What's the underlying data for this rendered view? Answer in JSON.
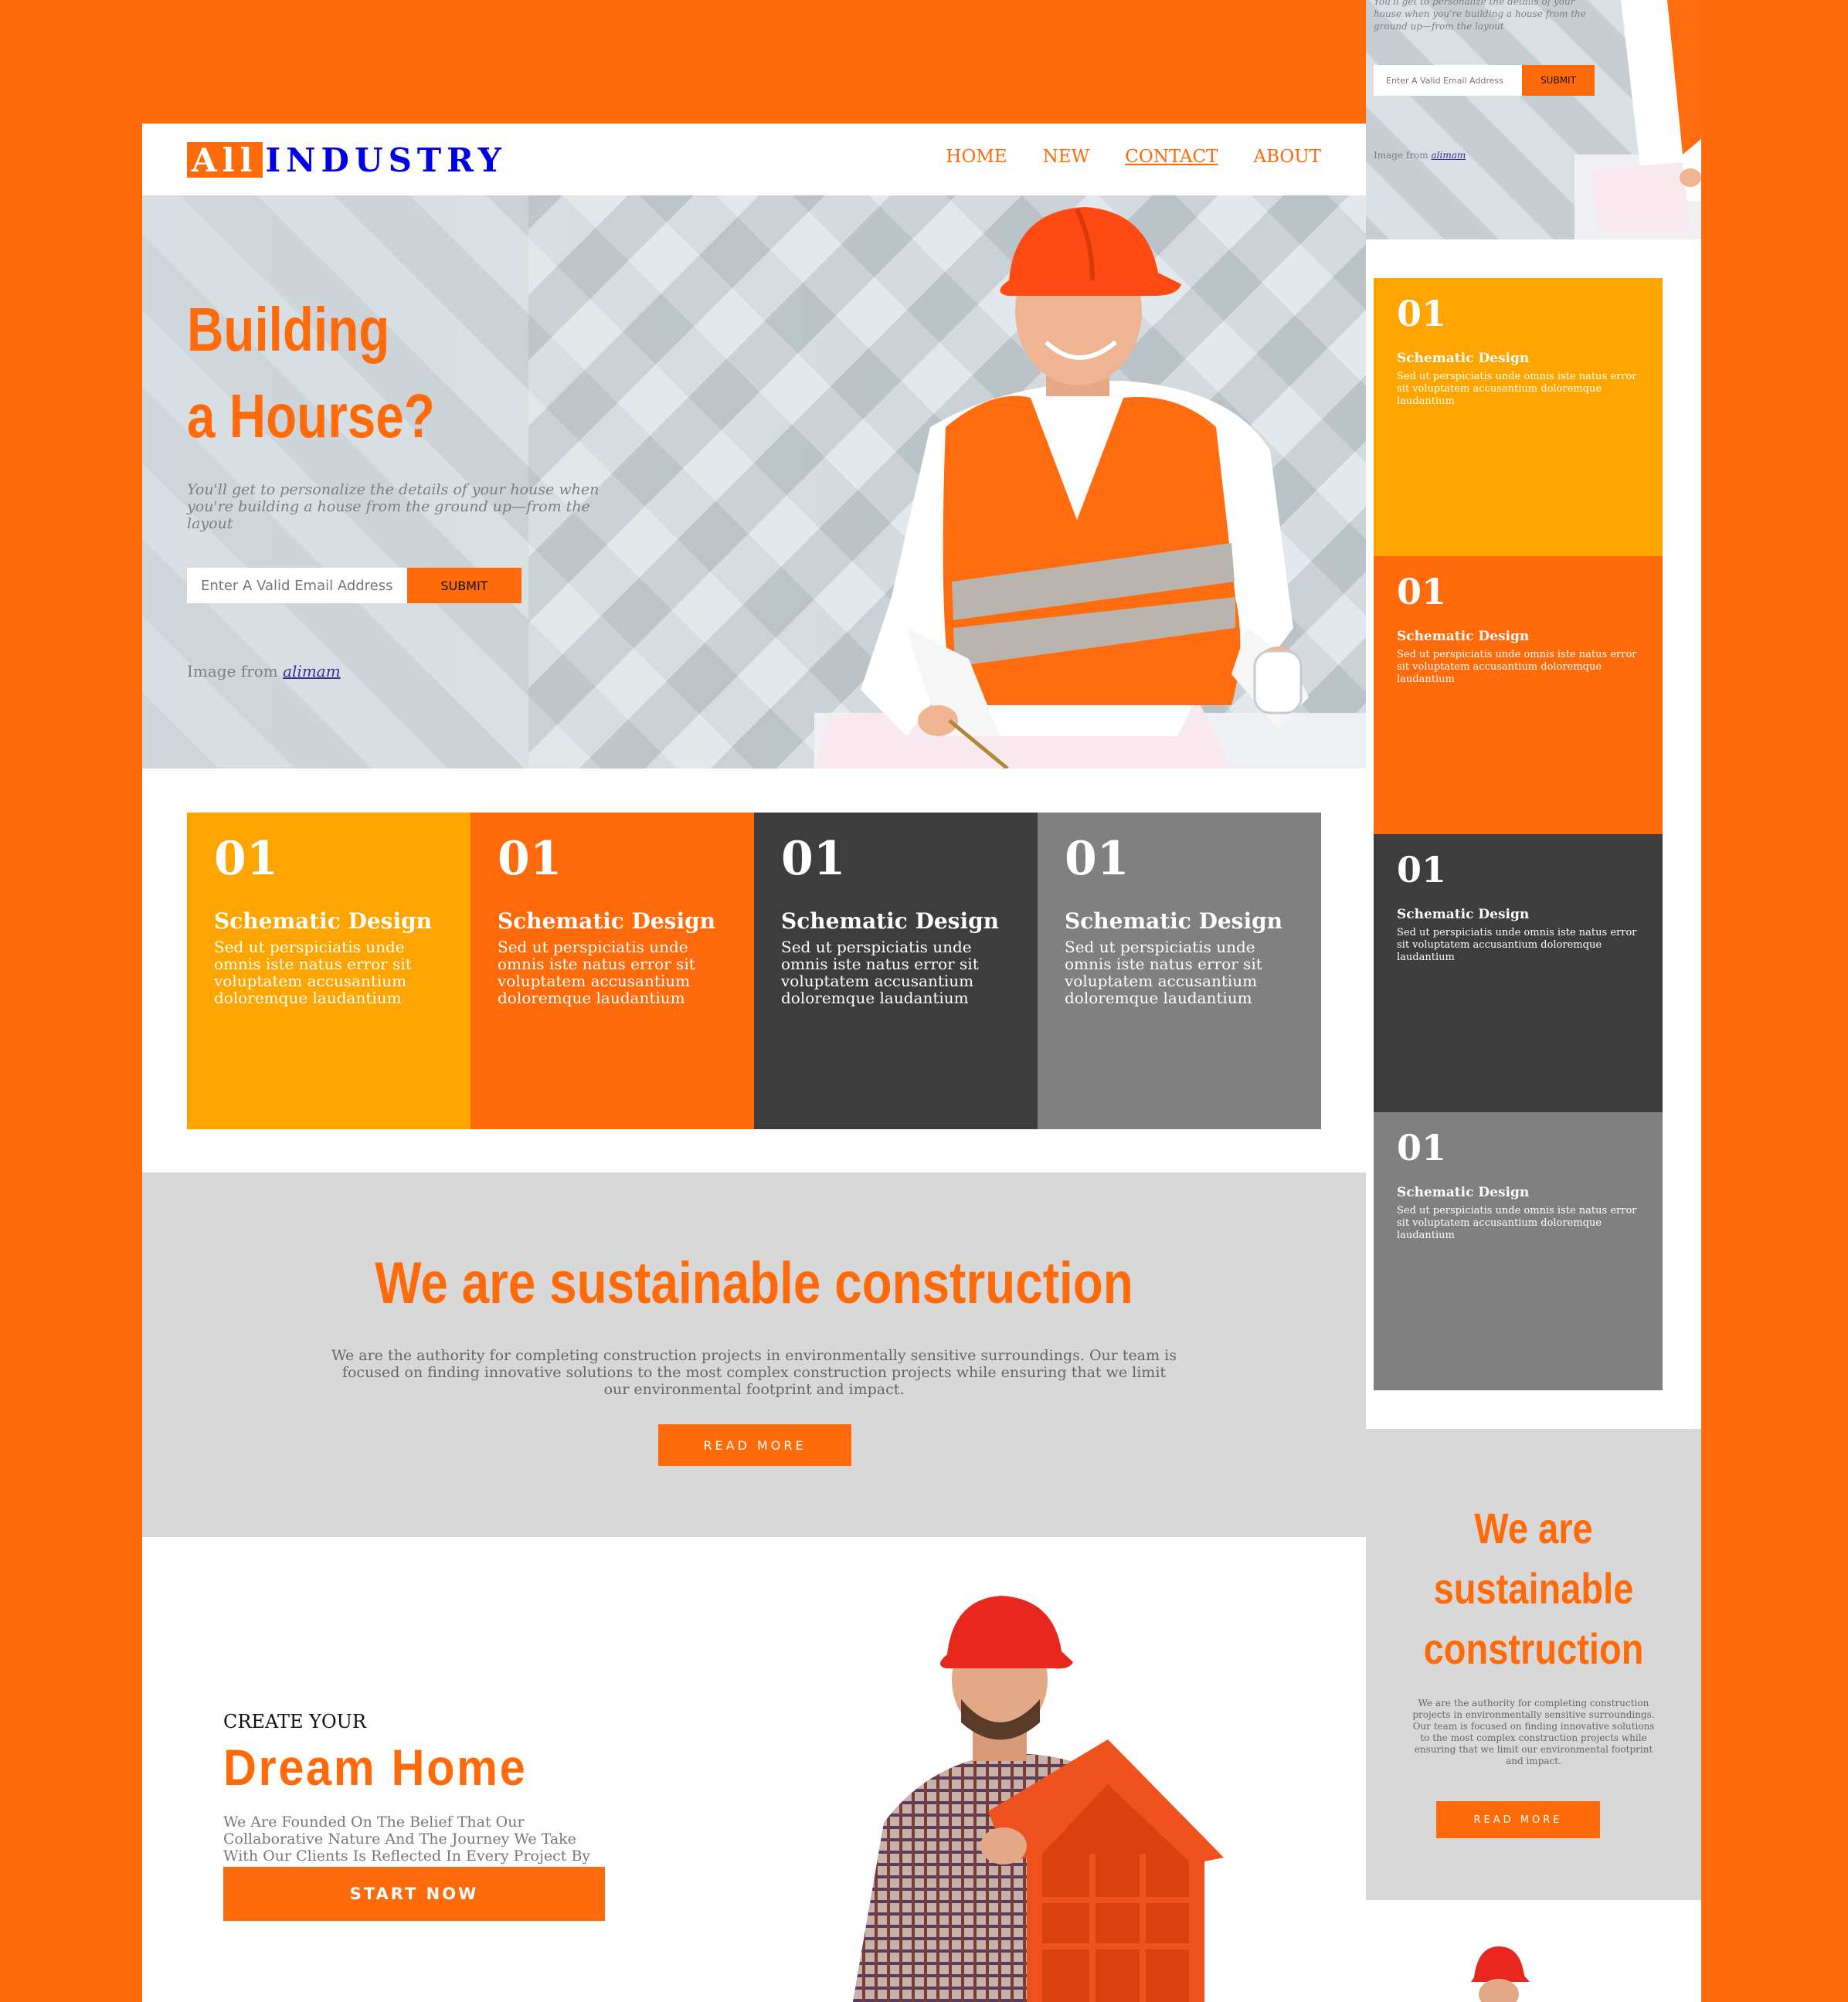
{
  "brand": {
    "part1": "All",
    "part2": "INDUSTRY"
  },
  "nav": {
    "items": [
      "HOME",
      "NEW",
      "CONTACT",
      "ABOUT"
    ],
    "active": "CONTACT"
  },
  "hero": {
    "title_line1": "Building",
    "title_line2": "a Hourse?",
    "subtitle": "You'll get to personalize the details of your house when you're building a house from the ground up—from the layout",
    "email_placeholder": "Enter A Valid Email Address",
    "submit_label": "SUBMIT",
    "credit_prefix": "Image from",
    "credit_link": "alimam"
  },
  "cards": [
    {
      "number": "01",
      "title": "Schematic Design",
      "text": "Sed ut perspiciatis unde omnis iste natus error sit voluptatem accusantium doloremque laudantium",
      "color": "#ffa500"
    },
    {
      "number": "01",
      "title": "Schematic Design",
      "text": "Sed ut perspiciatis unde omnis iste natus error sit voluptatem accusantium doloremque laudantium",
      "color": "#ff6a0a"
    },
    {
      "number": "01",
      "title": "Schematic Design",
      "text": "Sed ut perspiciatis unde omnis iste natus error sit voluptatem accusantium doloremque laudantium",
      "color": "#3d3d3d"
    },
    {
      "number": "01",
      "title": "Schematic Design",
      "text": "Sed ut perspiciatis unde omnis iste natus error sit voluptatem accusantium doloremque laudantium",
      "color": "#808080"
    }
  ],
  "sustain": {
    "title": "We are sustainable construction",
    "text": "We are the authority for completing construction projects in environmentally sensitive surroundings. Our team is focused on finding innovative solutions to the most complex construction projects while ensuring that we limit our environmental footprint and impact.",
    "button": "READ MORE"
  },
  "dream": {
    "kicker": "CREATE YOUR",
    "title": "Dream Home",
    "text": "We Are Founded On The Belief That Our Collaborative Nature And The Journey We Take With Our Clients Is Reflected In Every Project By Creating Exciting, Functional, Modern Spaces",
    "button": "START NOW"
  },
  "colors": {
    "accent": "#ff6a0a",
    "amber": "#ffa500",
    "dark": "#3d3d3d",
    "gray": "#808080",
    "section_gray": "#d8d8d8",
    "logo_blue": "#0000e6"
  }
}
